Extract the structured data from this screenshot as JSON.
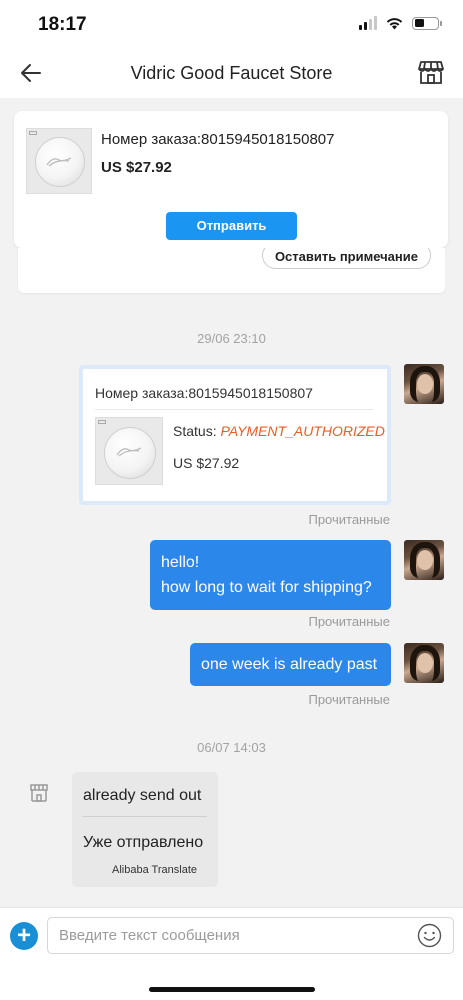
{
  "status_bar": {
    "time": "18:17"
  },
  "nav": {
    "title": "Vidric Good Faucet Store",
    "back_icon": "back-arrow-icon",
    "store_icon": "storefront-icon"
  },
  "pinned_order": {
    "order_number": "Номер заказа:8015945018150807",
    "price": "US $27.92",
    "send_label": "Отправить"
  },
  "previous_card": {
    "note_label": "Оставить примечание"
  },
  "messages": {
    "ts1": "29/06 23:10",
    "order_card": {
      "order_number": "Номер заказа:8015945018150807",
      "status_label": "Status: ",
      "status_value": "PAYMENT_AUTHORIZED",
      "price": "US $27.92",
      "read": "Прочитанные"
    },
    "msg1": {
      "line1": "hello!",
      "line2": "how long to wait for shipping?",
      "read": "Прочитанные"
    },
    "msg2": {
      "text": "one week is already past",
      "read": "Прочитанные"
    },
    "ts2": "06/07 14:03",
    "seller_msg": {
      "original": "already send out",
      "translated": "Уже отправлено",
      "translator": "Alibaba Translate"
    }
  },
  "input": {
    "placeholder": "Введите текст сообщения"
  },
  "colors": {
    "accent": "#1a95f1",
    "bubble_me": "#2c87ea",
    "status_value": "#f15a24",
    "bubble_them": "#e8e8e8"
  }
}
